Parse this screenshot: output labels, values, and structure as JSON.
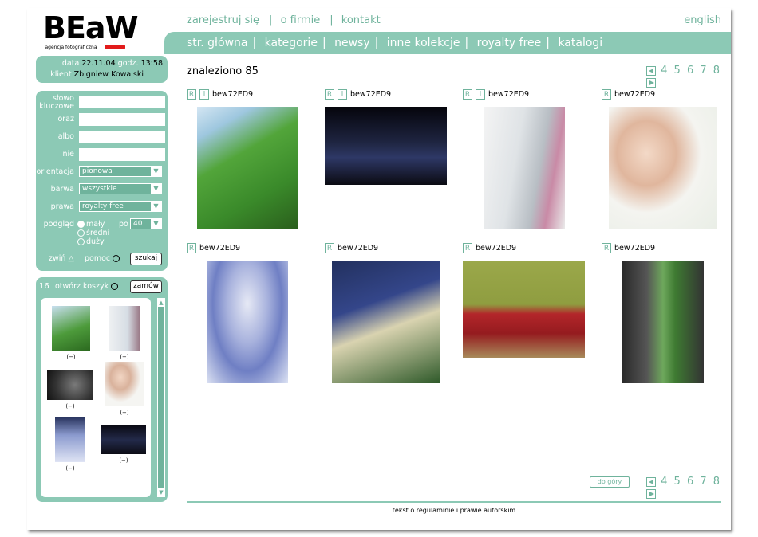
{
  "logo": {
    "text": "BEaW",
    "tagline": "agencja fotograficzna"
  },
  "topnav": [
    "zarejestruj się",
    "o firmie",
    "kontakt"
  ],
  "lang": "english",
  "mainnav": [
    "str. główna",
    "kategorie",
    "newsy",
    "inne kolekcje",
    "royalty free",
    "katalogi"
  ],
  "user": {
    "date_label": "data",
    "date": "22.11.04",
    "time_label": "godz.",
    "time": "13:58",
    "client_label": "klient",
    "client": "Zbigniew Kowalski"
  },
  "search": {
    "keywords_label": "słowo kluczowe",
    "and_label": "oraz",
    "or_label": "albo",
    "not_label": "nie",
    "orientation_label": "orientacja",
    "orientation_value": "pionowa",
    "color_label": "barwa",
    "color_value": "wszystkie",
    "rights_label": "prawa",
    "rights_value": "royalty free",
    "preview_label": "podgląd",
    "sizes": [
      "mały",
      "średni",
      "duży"
    ],
    "per_label": "po",
    "per_value": "40",
    "collapse_label": "zwiń",
    "help_label": "pomoc",
    "search_button": "szukaj"
  },
  "cart": {
    "count": "16",
    "open_label": "otwórz koszyk",
    "order_button": "zamów",
    "caption": "(−)"
  },
  "results": {
    "found_label": "znaleziono 85",
    "pages": "4 5 6 7 8",
    "back_to_top": "do góry"
  },
  "items": [
    {
      "code": "bew72ED9",
      "icons": [
        "R",
        "i"
      ]
    },
    {
      "code": "bew72ED9",
      "icons": [
        "R",
        "i"
      ]
    },
    {
      "code": "bew72ED9",
      "icons": [
        "R",
        "i"
      ]
    },
    {
      "code": "bew72ED9",
      "icons": [
        "R"
      ]
    },
    {
      "code": "bew72ED9",
      "icons": [
        "R"
      ]
    },
    {
      "code": "bew72ED9",
      "icons": [
        "R"
      ]
    },
    {
      "code": "bew72ED9",
      "icons": [
        "R"
      ]
    },
    {
      "code": "bew72ED9",
      "icons": [
        "R"
      ]
    }
  ],
  "footer": "tekst o regulaminie i prawie autorskim",
  "colors": {
    "accent": "#8cc9b5",
    "accent_dark": "#6fb39c",
    "logo_red": "#e21b1b"
  }
}
